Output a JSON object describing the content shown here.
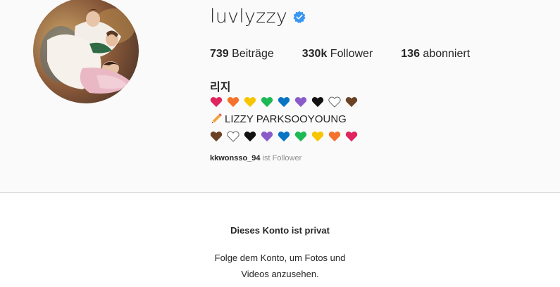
{
  "profile": {
    "username": "luvlyzzy",
    "verified": true,
    "full_name": "리지",
    "stats": {
      "posts_count": "739",
      "posts_label": "Beiträge",
      "followers_count": "330k",
      "followers_label": "Follower",
      "following_count": "136",
      "following_label": "abonniert"
    },
    "bio": {
      "hearts_line1": [
        "#e0245e",
        "#f4722b",
        "#f7c600",
        "#1db954",
        "#0a74c4",
        "#8a5cc9",
        "#111111",
        "#ffffff",
        "#6b4226"
      ],
      "pencil_icon": "pencil-icon",
      "line2_text": "LIZZY PARKSOOYOUNG",
      "hearts_line3": [
        "#6b4226",
        "#ffffff",
        "#111111",
        "#8a5cc9",
        "#0a74c4",
        "#1db954",
        "#f7c600",
        "#f4722b",
        "#e0245e"
      ]
    },
    "followed_by": {
      "name": "kkwonsso_94",
      "suffix": "ist Follower"
    }
  },
  "private_notice": {
    "title": "Dieses Konto ist privat",
    "line1": "Folge dem Konto, um Fotos und",
    "line2": "Videos anzusehen."
  },
  "colors": {
    "verified_badge": "#3897f0",
    "text_primary": "#262626",
    "text_secondary": "#8e8e8e"
  }
}
